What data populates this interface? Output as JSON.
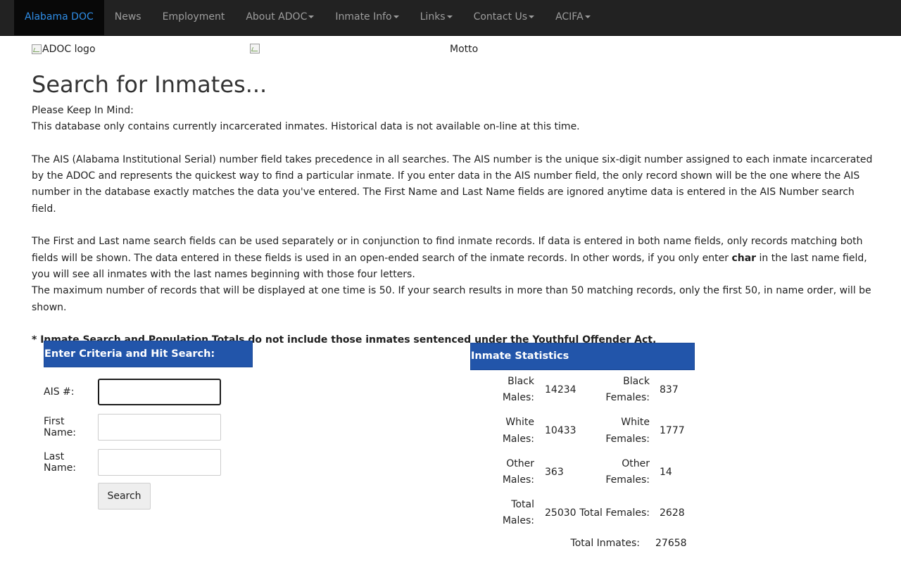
{
  "nav": {
    "items": [
      {
        "label": "Alabama DOC",
        "active": true,
        "dropdown": false
      },
      {
        "label": "News",
        "dropdown": false
      },
      {
        "label": "Employment",
        "dropdown": false
      },
      {
        "label": "About ADOC",
        "dropdown": true
      },
      {
        "label": "Inmate Info",
        "dropdown": true
      },
      {
        "label": "Links",
        "dropdown": true
      },
      {
        "label": "Contact Us",
        "dropdown": true
      },
      {
        "label": "ACIFA",
        "dropdown": true
      }
    ]
  },
  "header": {
    "logo_alt": "ADOC logo",
    "motto_alt": "Motto"
  },
  "page": {
    "title": "Search for Inmates...",
    "keep_in_mind": "Please Keep In Mind:",
    "para1": "This database only contains currently incarcerated inmates. Historical data is not available on-line at this time.",
    "para2": "The AIS (Alabama Institutional Serial) number field takes precedence in all searches. The AIS number is the unique six-digit number assigned to each inmate incarcerated by the ADOC and represents the quickest way to find a particular inmate. If you enter data in the AIS number field, the only record shown will be the one where the AIS number in the database exactly matches the data you've entered. The First Name and Last Name fields are ignored anytime data is entered in the AIS Number search field.",
    "para3_before": "The First and Last name search fields can be used separately or in conjunction to find inmate records. If data is entered in both name fields, only records matching both fields will be shown. The data entered in these fields is used in an open-ended search of the inmate records. In other words, if you only enter ",
    "para3_bold": "char",
    "para3_after": " in the last name field, you will see all inmates with the last names beginning with those four letters.",
    "para4": "The maximum number of records that will be displayed at one time is 50. If your search results in more than 50 matching records, only the first 50, in name order, will be shown.",
    "youthful_note": "* Inmate Search and Population Totals do not include those inmates sentenced under the Youthful Offender Act."
  },
  "search": {
    "header": "Enter Criteria and Hit Search:",
    "ais_label": "AIS #:",
    "ais_value": "",
    "first_label": "First Name:",
    "first_value": "",
    "last_label": "Last Name:",
    "last_value": "",
    "button": "Search"
  },
  "stats": {
    "header": "Inmate Statistics",
    "black_males_label": "Black Males:",
    "black_males": "14234",
    "black_females_label": "Black Females:",
    "black_females": "837",
    "white_males_label": "White Males:",
    "white_males": "10433",
    "white_females_label": "White Females:",
    "white_females": "1777",
    "other_males_label": "Other Males:",
    "other_males": "363",
    "other_females_label": "Other Females:",
    "other_females": "14",
    "total_males_label": "Total Males:",
    "total_males": "25030",
    "total_females_label": "Total Females:",
    "total_females": "2628",
    "total_inmates_label": "Total Inmates:",
    "total_inmates": "27658"
  },
  "colors": {
    "navbar_bg": "#222222",
    "nav_active_text": "#2f8ee8",
    "panel_header_bg": "#2255aa"
  }
}
